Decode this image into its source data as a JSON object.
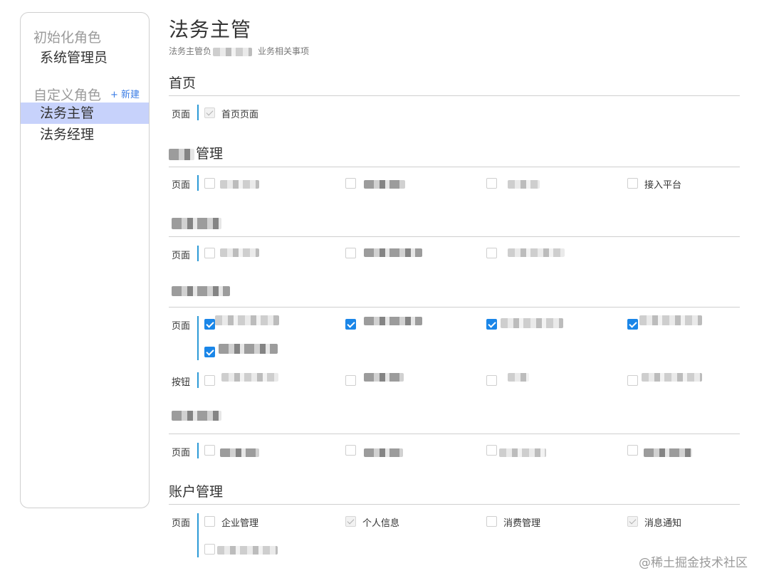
{
  "sidebar": {
    "init_title": "初始化角色",
    "init_items": [
      "系统管理员"
    ],
    "custom_title": "自定义角色",
    "new_label": "+ 新建",
    "custom_items": [
      "法务主管",
      "法务经理"
    ],
    "active_item": "法务主管"
  },
  "header": {
    "title": "法务主管",
    "desc_prefix": "法务主管负",
    "desc_suffix": "业务相关事项"
  },
  "sections": {
    "home": {
      "title": "首页",
      "row_label": "页面",
      "items": [
        {
          "label": "首页页面",
          "state": "checked-gray"
        }
      ]
    },
    "manage": {
      "title_suffix": "管理",
      "row1_label": "页面",
      "row1_item4": "接入平台",
      "row2_label": "页面",
      "row3_label_page": "页面",
      "row3_label_button": "按钮",
      "row4_label": "页面"
    },
    "account": {
      "title": "账户管理",
      "row_label": "页面",
      "items": [
        {
          "label": "企业管理",
          "state": "unchecked"
        },
        {
          "label": "个人信息",
          "state": "checked-gray"
        },
        {
          "label": "消费管理",
          "state": "unchecked"
        },
        {
          "label": "消息通知",
          "state": "checked-gray"
        }
      ]
    }
  },
  "watermark": "@稀土掘金技术社区",
  "colors": {
    "accent": "#1a86e8",
    "active_bg": "#c7d2fb",
    "bar": "#2d9ad6"
  }
}
